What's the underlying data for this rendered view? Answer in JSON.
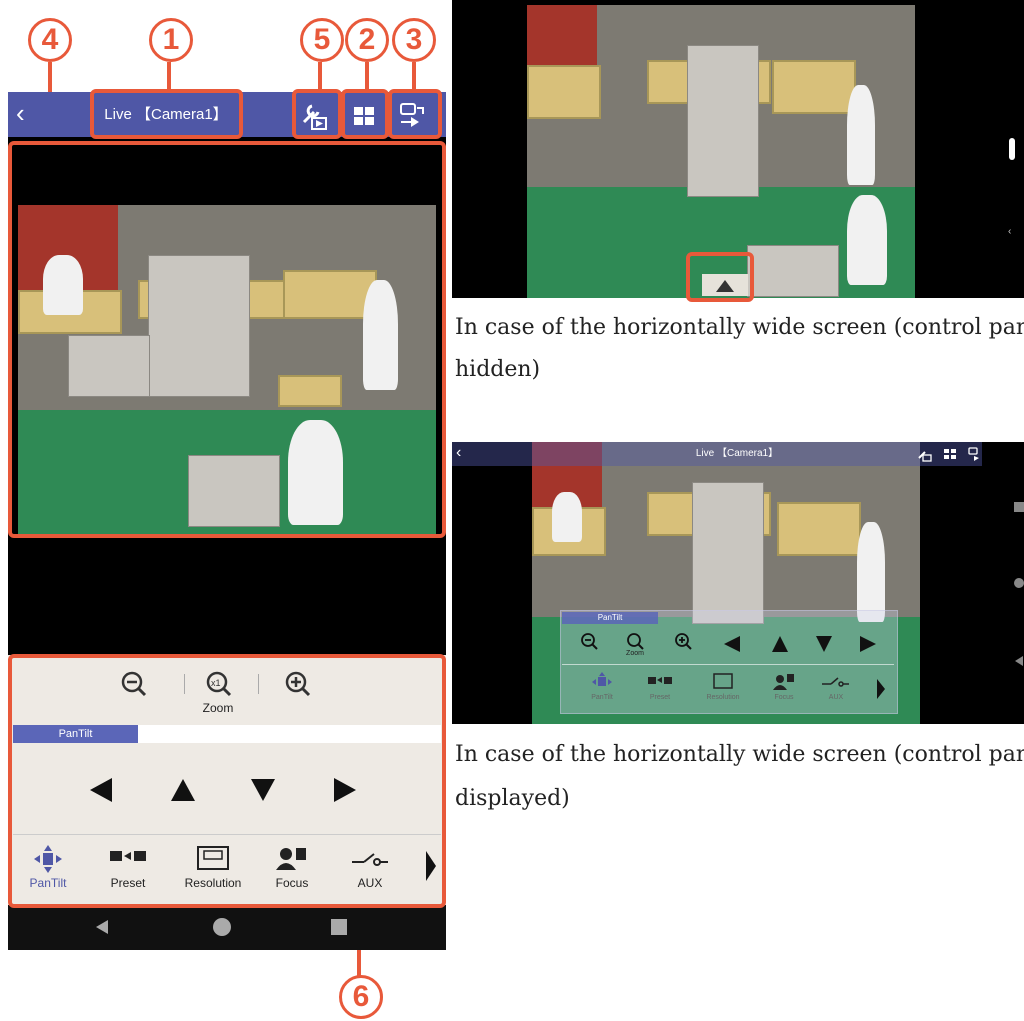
{
  "callouts": {
    "c1": "1",
    "c2": "2",
    "c3": "3",
    "c4": "4",
    "c5": "5",
    "c6": "6"
  },
  "phone": {
    "title": "Live 【Camera1】",
    "zoom_label": "Zoom",
    "zoom_reset_glyph": "x1",
    "tab_label": "PanTilt",
    "nav_items": [
      {
        "label": "PanTilt",
        "icon": "pantilt-icon"
      },
      {
        "label": "Preset",
        "icon": "preset-icon"
      },
      {
        "label": "Resolution",
        "icon": "resolution-icon"
      },
      {
        "label": "Focus",
        "icon": "focus-icon"
      },
      {
        "label": "AUX",
        "icon": "aux-icon"
      }
    ]
  },
  "landscape_bottom": {
    "title": "Live 【Camera1】",
    "tab_label": "PanTilt",
    "zoom_label": "Zoom",
    "nav_items": [
      {
        "label": "PanTilt"
      },
      {
        "label": "Preset"
      },
      {
        "label": "Resolution"
      },
      {
        "label": "Focus"
      },
      {
        "label": "AUX"
      }
    ]
  },
  "captions": {
    "hidden_line1": "In case of the horizontally wide screen (control pan",
    "hidden_line2": "hidden)",
    "displayed_line1": "In case of the horizontally wide screen (control pan",
    "displayed_line2": "displayed)"
  },
  "colors": {
    "accent": "#e8593a",
    "appbar": "#4f57a6",
    "tab": "#5b66b8",
    "panel_bg": "#eeeae4"
  }
}
